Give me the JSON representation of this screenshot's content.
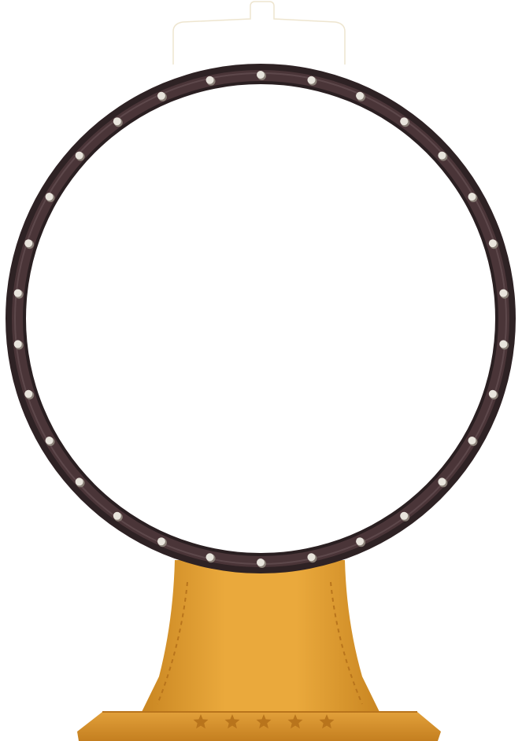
{
  "colors": {
    "background": "#ffffff",
    "ring_outer": "#2e2224",
    "ring_inner": "#4a3538",
    "ring_highlight": "#6b5558",
    "rivet": "#e8e4dc",
    "rivet_shadow": "#8a8078",
    "stand_body": "#e6a435",
    "stand_shadow": "#c98622",
    "stand_light": "#f0b54a",
    "stand_base": "#d9902a",
    "stitch": "#b8741c",
    "hanger_outline": "#eee5cf"
  },
  "icons": {
    "hanger": "hanger-tab-icon",
    "rivet": "rivet-icon",
    "star": "star-icon"
  },
  "rivet_count": 30,
  "base_star_count": 5
}
